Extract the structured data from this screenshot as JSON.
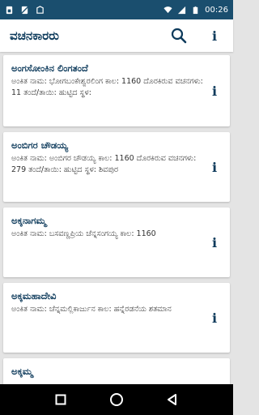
{
  "status_bar": {
    "time": "00:26",
    "icons": [
      "sim-icon",
      "no-sim-icon",
      "notification-icon",
      "wifi-icon",
      "signal-icon",
      "battery-icon"
    ]
  },
  "app_bar": {
    "title": "ವಚನಕಾರರು",
    "icons": [
      "search-icon",
      "info-icon"
    ]
  },
  "cards": [
    {
      "name": "ಅಂಗಸೋಂಕಿನ ಲಿಂಗತಂದೆ",
      "details": "ಅಂಕಿತ ನಾಮ: ಭೋಗಬಂಕೇಶ್ವರಲಿಂಗ ಕಾಲ: 1160 ದೊರಕಿರುವ ವಚನಗಳು: 11  ತಂದೆ/ತಾಯಿ: ಹುಟ್ಟಿದ ಸ್ಥಳ:"
    },
    {
      "name": "ಅಂಬಿಗರ ಚೌಡಯ್ಯ",
      "details": "ಅಂಕಿತ ನಾಮ: ಅಂಬಿಗರ ಚೌಡಯ್ಯ ಕಾಲ: 1160 ದೊರಕಿರುವ ವಚನಗಳು: 279  ತಂದೆ/ತಾಯಿ: ಹುಟ್ಟಿದ ಸ್ಥಳ: ಶಿವಪುರ"
    },
    {
      "name": "ಅಕ್ಕನಾಗಮ್ಮ",
      "details": "ಅಂಕಿತ ನಾಮ:  ಬಸವಣ್ಣಪ್ರಿಯ ಚೆನ್ನಸಂಗಯ್ಯ ಕಾಲ: 1160"
    },
    {
      "name": "ಅಕ್ಕಮಹಾದೇವಿ",
      "details": "ಅಂಕಿತ ನಾಮ: ಚೆನ್ನಮಲ್ಲಿಕಾರ್ಜುನ ಕಾಲ: ಹನ್ನೆರಡನೆಯ ಶತಮಾನ"
    },
    {
      "name": "ಅಕ್ಕಮ್ಮ",
      "details": ""
    }
  ],
  "nav_bar": {
    "icons": [
      "recents-icon",
      "home-icon",
      "back-icon"
    ]
  },
  "colors": {
    "status_bar": "#1a4e6e",
    "accent": "#0d3a5b",
    "background": "#e4e4e4"
  }
}
